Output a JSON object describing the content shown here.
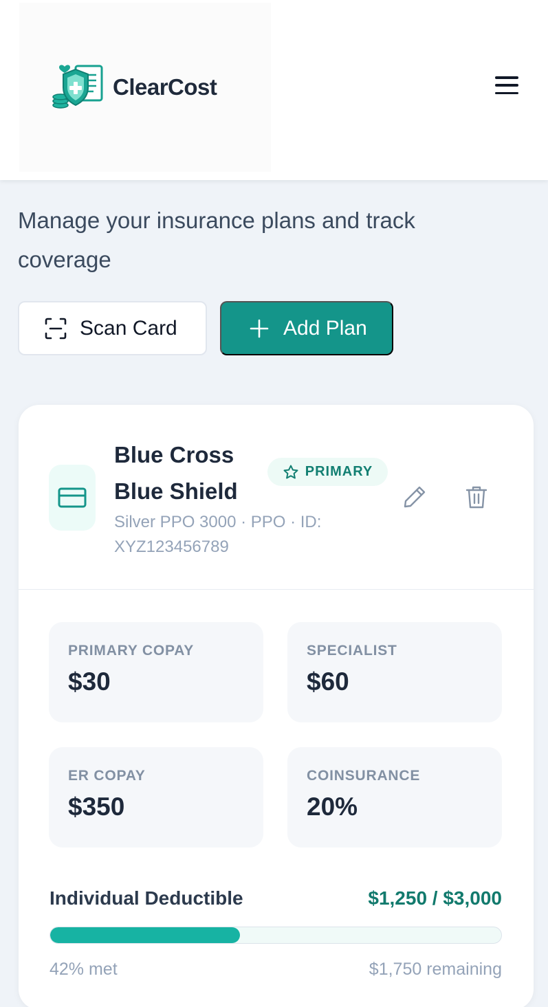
{
  "app": {
    "name": "ClearCost"
  },
  "page": {
    "subtitle": "Manage your insurance plans and track coverage"
  },
  "actions": {
    "scan_label": "Scan Card",
    "add_label": "Add Plan"
  },
  "plan": {
    "name": "Blue Cross Blue Shield",
    "badge": "PRIMARY",
    "meta": "Silver PPO 3000 · PPO · ID: XYZ123456789",
    "stats": [
      {
        "label": "PRIMARY COPAY",
        "value": "$30"
      },
      {
        "label": "SPECIALIST",
        "value": "$60"
      },
      {
        "label": "ER COPAY",
        "value": "$350"
      },
      {
        "label": "COINSURANCE",
        "value": "20%"
      }
    ],
    "deductible": {
      "label": "Individual Deductible",
      "amount": "$1,250 / $3,000",
      "progress": 0.42,
      "met_text": "42% met",
      "remaining_text": "$1,750 remaining"
    }
  },
  "colors": {
    "brand_teal": "#14958a",
    "progress_fill": "#17b3a3",
    "badge_text": "#127f72",
    "page_bg": "#eff3f8"
  },
  "icons": {
    "logo": "shield-plus-coins-icon",
    "menu": "hamburger-menu-icon",
    "scan": "scan-frame-icon",
    "add": "plus-icon",
    "plan": "credit-card-icon",
    "badge": "star-icon",
    "edit": "pencil-icon",
    "delete": "trash-icon"
  }
}
